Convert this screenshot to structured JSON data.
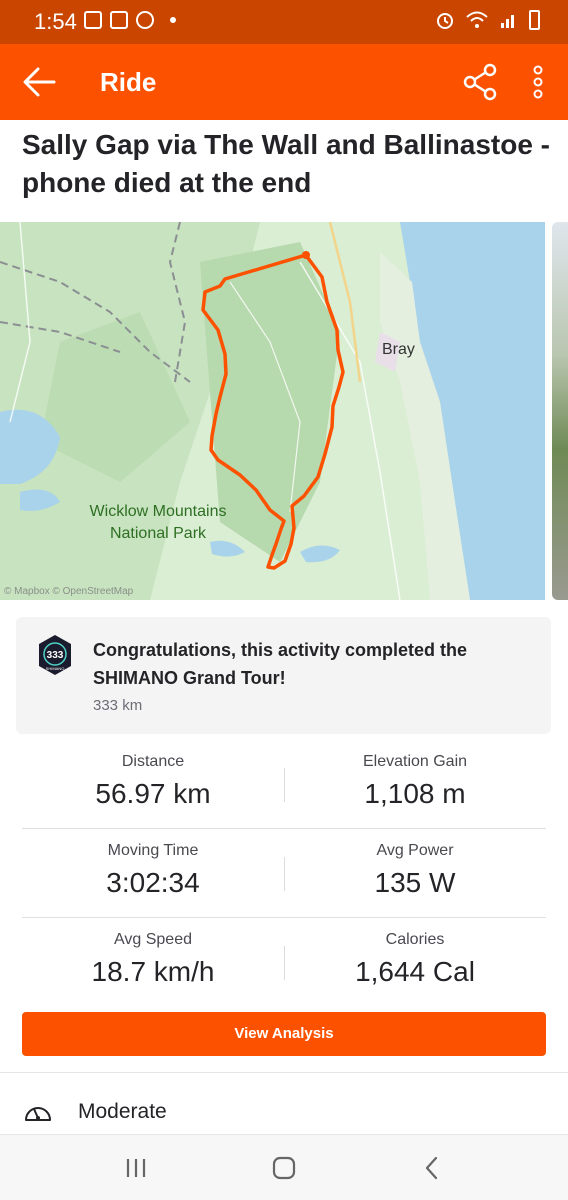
{
  "status_bar": {
    "time": "1:54",
    "left_icons": [
      "gallery-icon",
      "linkedin-icon",
      "whatsapp-icon",
      "notification-dot"
    ],
    "right_icons": [
      "alarm-icon",
      "wifi-icon",
      "signal-icon",
      "battery-charging-icon"
    ]
  },
  "app_bar": {
    "title": "Ride",
    "color": "#fc5200",
    "icons": [
      "back-arrow-icon",
      "share-icon",
      "more-vertical-icon"
    ]
  },
  "activity": {
    "title": "Sally Gap via The Wall and Ballinastoe - phone died at the end"
  },
  "map": {
    "labels": {
      "town": "Bray",
      "park_line1": "Wicklow Mountains",
      "park_line2": "National Park",
      "attribution": "© Mapbox © OpenStreetMap"
    },
    "route_color": "#fc5200"
  },
  "achievement": {
    "text": "Congratulations, this activity completed the SHIMANO Grand Tour!",
    "subtitle": "333 km",
    "badge_number": "333",
    "badge_caption": "SHIMANO"
  },
  "stats": [
    {
      "label": "Distance",
      "value": "56.97 km"
    },
    {
      "label": "Elevation Gain",
      "value": "1,108 m"
    },
    {
      "label": "Moving Time",
      "value": "3:02:34"
    },
    {
      "label": "Avg Power",
      "value": "135 W"
    },
    {
      "label": "Avg Speed",
      "value": "18.7 km/h"
    },
    {
      "label": "Calories",
      "value": "1,644 Cal"
    }
  ],
  "analysis_button": "View Analysis",
  "effort": {
    "label": "Moderate",
    "icon": "gauge-icon"
  },
  "nav_bar": {
    "icons": [
      "recent-apps-icon",
      "home-icon",
      "back-icon"
    ]
  }
}
